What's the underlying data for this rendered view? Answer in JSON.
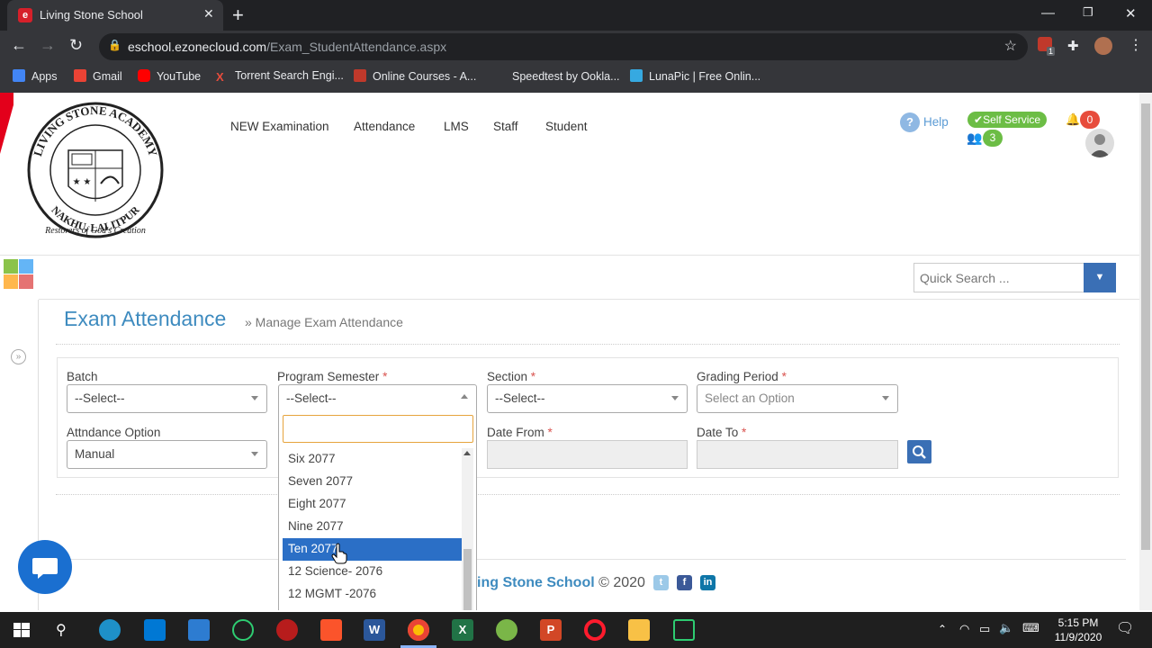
{
  "browser": {
    "tab_title": "Living Stone School",
    "url_host": "eschool.ezonecloud.com",
    "url_path": "/Exam_StudentAttendance.aspx",
    "extension_badge": "1",
    "bookmarks": [
      "Apps",
      "Gmail",
      "YouTube",
      "Torrent Search Engi...",
      "Online Courses - A...",
      "Speedtest by Ookla...",
      "LunaPic | Free Onlin..."
    ]
  },
  "header": {
    "nav": [
      "NEW Examination",
      "Attendance",
      "LMS",
      "Staff",
      "Student"
    ],
    "help": "Help",
    "self_service": "Self Service",
    "notifications": "0",
    "users_count": "3",
    "quick_search_placeholder": "Quick Search ..."
  },
  "page": {
    "title": "Exam Attendance",
    "subtitle": "» Manage Exam Attendance"
  },
  "form": {
    "batch_label": "Batch",
    "batch_value": "--Select--",
    "program_label": "Program Semester",
    "program_value": "--Select--",
    "section_label": "Section",
    "section_value": "--Select--",
    "grading_label": "Grading Period",
    "grading_value": "Select an Option",
    "option_label": "Attndance Option",
    "option_value": "Manual",
    "date_from_label": "Date From",
    "date_to_label": "Date To",
    "required_mark": "*"
  },
  "dropdown": {
    "options": [
      "Six 2077",
      "Seven 2077",
      "Eight 2077",
      "Nine 2077",
      "Ten 2077",
      "12 Science- 2076",
      "12 MGMT -2076"
    ],
    "highlighted": "Ten 2077"
  },
  "footer": {
    "brand": "ing Stone School",
    "copyright": "© 2020"
  },
  "taskbar": {
    "time": "5:15 PM",
    "date": "11/9/2020"
  },
  "colors": {
    "accent": "#3e8bbf",
    "brand_red": "#e3001b",
    "button_blue": "#3a6fb5",
    "highlight": "#2b6fc6",
    "green": "#6cbd45"
  }
}
